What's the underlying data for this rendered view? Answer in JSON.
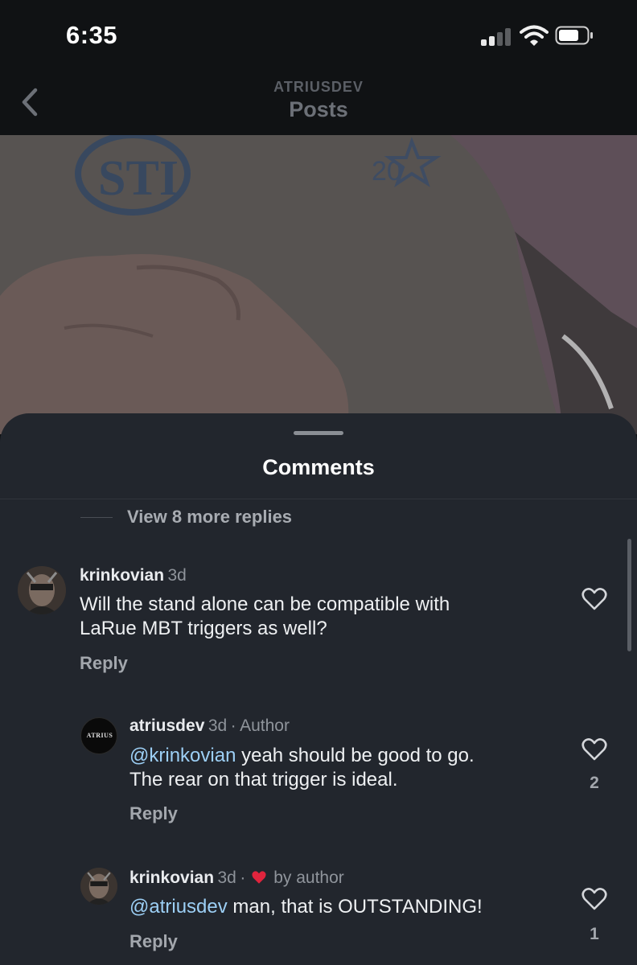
{
  "status_bar": {
    "time": "6:35"
  },
  "nav": {
    "subtitle": "ATRIUSDEV",
    "title": "Posts"
  },
  "comments_sheet": {
    "title": "Comments",
    "view_more": "View 8 more replies",
    "comments": [
      {
        "username": "krinkovian",
        "age": "3d",
        "text_lines": [
          "Will the stand alone can be compatible with",
          "LaRue MBT triggers as well?"
        ],
        "reply_label": "Reply"
      },
      {
        "username": "atriusdev",
        "age": "3d",
        "separator": "·",
        "tag": "Author",
        "avatar_text": "ATRIUS",
        "mention": "@krinkovian",
        "text_line1_rest": " yeah should be good to go.",
        "text_line2": "The rear on that trigger is ideal.",
        "reply_label": "Reply",
        "like_count": "2"
      },
      {
        "username": "krinkovian",
        "age": "3d",
        "separator": "·",
        "liked_by": "by author",
        "mention": "@atriusdev",
        "text_rest": " man, that is OUTSTANDING!",
        "reply_label": "Reply",
        "like_count": "1"
      }
    ]
  },
  "colors": {
    "sheet": "#22262d",
    "mention": "#9ccff5",
    "liked_heart": "#e0243d"
  },
  "icons": [
    "back-chevron-icon",
    "signal-icon",
    "wifi-icon",
    "battery-icon",
    "heart-outline-icon",
    "heart-filled-icon"
  ]
}
